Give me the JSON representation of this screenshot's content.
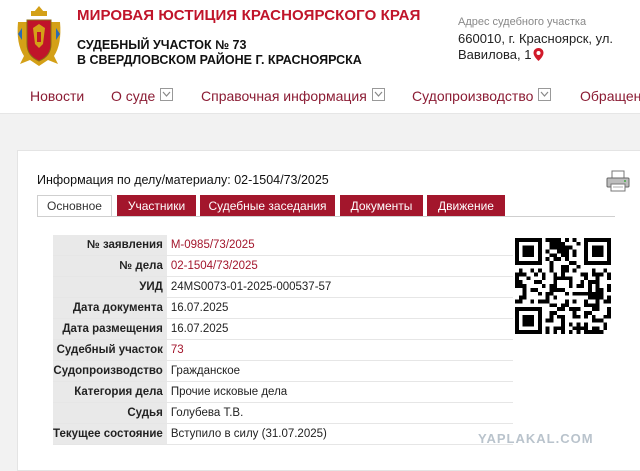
{
  "header": {
    "site_title": "МИРОВАЯ ЮСТИЦИЯ КРАСНОЯРСКОГО КРАЯ",
    "court_line1": "СУДЕБНЫЙ УЧАСТОК № 73",
    "court_line2": "В СВЕРДЛОВСКОМ РАЙОНЕ Г. КРАСНОЯРСКА",
    "address_label": "Адрес судебного участка",
    "address_line1": "660010, г. Красноярск, ул.",
    "address_line2": "Вавилова, 1"
  },
  "nav": {
    "items": [
      {
        "label": "Новости",
        "has_dropdown": false
      },
      {
        "label": "О суде",
        "has_dropdown": true
      },
      {
        "label": "Справочная информация",
        "has_dropdown": true
      },
      {
        "label": "Судопроизводство",
        "has_dropdown": true
      },
      {
        "label": "Обращен",
        "has_dropdown": false
      }
    ]
  },
  "case": {
    "heading": "Информация по делу/материалу: 02-1504/73/2025",
    "tabs": [
      {
        "label": "Основное",
        "active": true
      },
      {
        "label": "Участники",
        "active": false
      },
      {
        "label": "Судебные заседания",
        "active": false
      },
      {
        "label": "Документы",
        "active": false
      },
      {
        "label": "Движение",
        "active": false
      }
    ],
    "rows": [
      {
        "label": "№ заявления",
        "value": "М-0985/73/2025",
        "link": true
      },
      {
        "label": "№ дела",
        "value": "02-1504/73/2025",
        "link": true
      },
      {
        "label": "УИД",
        "value": "24MS0073-01-2025-000537-57",
        "link": false
      },
      {
        "label": "Дата документа",
        "value": "16.07.2025",
        "link": false
      },
      {
        "label": "Дата размещения",
        "value": "16.07.2025",
        "link": false
      },
      {
        "label": "Судебный участок",
        "value": "73",
        "link": true
      },
      {
        "label": "Судопроизводство",
        "value": "Гражданское",
        "link": false
      },
      {
        "label": "Категория дела",
        "value": "Прочие исковые дела",
        "link": false
      },
      {
        "label": "Судья",
        "value": "Голубева Т.В.",
        "link": false
      },
      {
        "label": "Текущее состояние",
        "value": "Вступило в силу (31.07.2025)",
        "link": false
      }
    ]
  },
  "watermark": "YAPLAKAL.COM",
  "colors": {
    "brand": "#c0142a",
    "tab_bg": "#a3162c",
    "nav_text": "#8b1c34",
    "label_bg": "#e9e9e9"
  },
  "icons": [
    "coat-of-arms-icon",
    "map-pin-icon",
    "chevron-down-icon",
    "printer-icon",
    "qr-code"
  ]
}
